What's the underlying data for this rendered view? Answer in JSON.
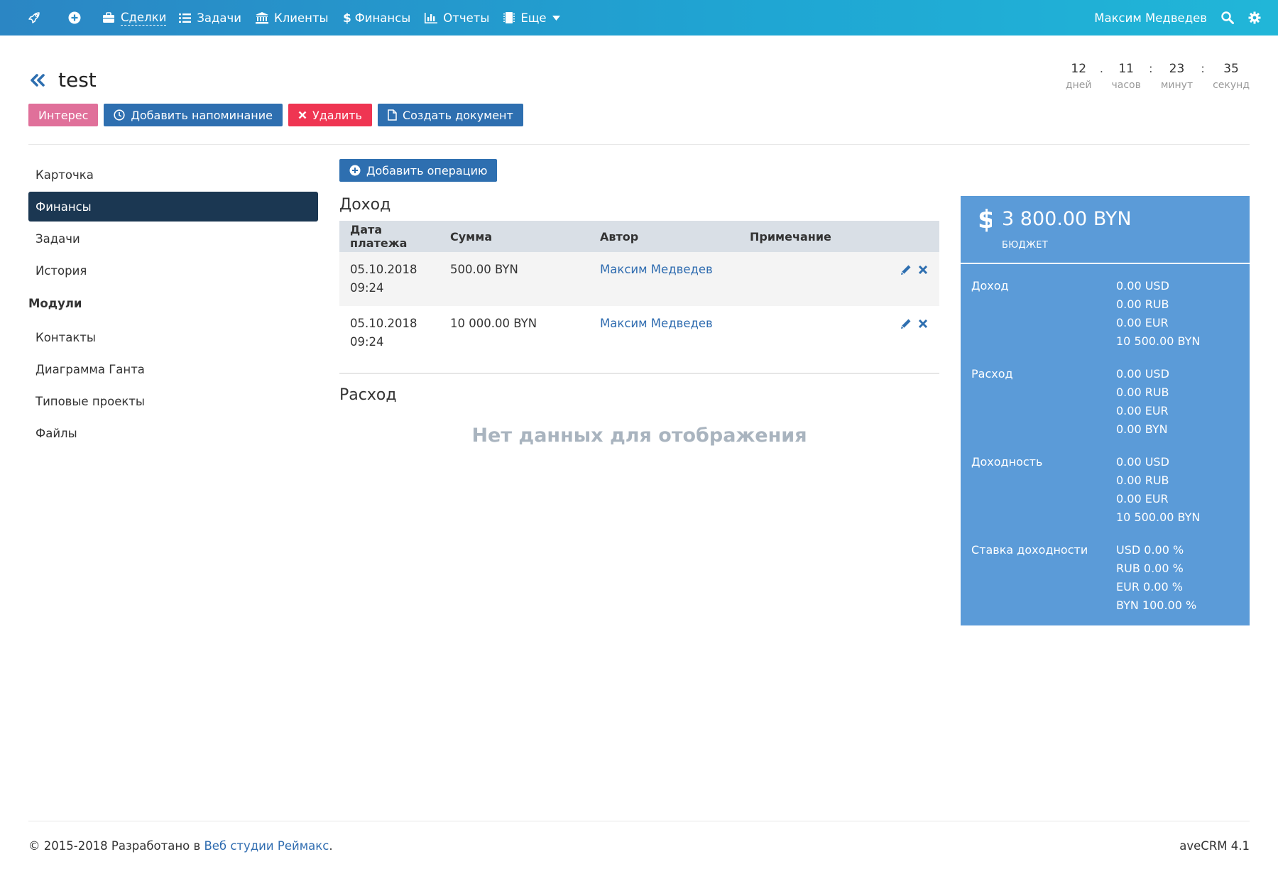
{
  "nav": {
    "items": [
      {
        "label": "Сделки",
        "icon": "briefcase-icon"
      },
      {
        "label": "Задачи",
        "icon": "list-icon"
      },
      {
        "label": "Клиенты",
        "icon": "bank-icon"
      },
      {
        "label": "Финансы",
        "icon": "dollar-icon"
      },
      {
        "label": "Отчеты",
        "icon": "bar-chart-icon"
      },
      {
        "label": "Еще",
        "icon": "chip-icon"
      }
    ],
    "user": "Максим Медведев"
  },
  "page": {
    "title": "test"
  },
  "timer": {
    "days": "12",
    "days_label": "дней",
    "hours": "11",
    "hours_label": "часов",
    "minutes": "23",
    "minutes_label": "минут",
    "seconds": "35",
    "seconds_label": "секунд",
    "sep1": ".",
    "sep2": ":",
    "sep3": ":"
  },
  "actions": {
    "status_label": "Интерес",
    "reminder_label": "Добавить напоминание",
    "delete_label": "Удалить",
    "create_doc_label": "Создать документ"
  },
  "sidebar": {
    "items": [
      "Карточка",
      "Финансы",
      "Задачи",
      "История"
    ],
    "modules_heading": "Модули",
    "modules": [
      "Контакты",
      "Диаграмма Ганта",
      "Типовые проекты",
      "Файлы"
    ]
  },
  "main": {
    "add_operation_label": "Добавить операцию",
    "income_title": "Доход",
    "columns": [
      "Дата платежа",
      "Сумма",
      "Автор",
      "Примечание"
    ],
    "income_rows": [
      {
        "date": "05.10.2018",
        "time": "09:24",
        "amount": "500.00 BYN",
        "author": "Максим Медведев",
        "note": ""
      },
      {
        "date": "05.10.2018",
        "time": "09:24",
        "amount": "10 000.00 BYN",
        "author": "Максим Медведев",
        "note": ""
      }
    ],
    "expense_title": "Расход",
    "no_data": "Нет данных для отображения"
  },
  "summary": {
    "budget_amount": "3 800.00 BYN",
    "budget_label": "Бюджет",
    "groups": [
      {
        "label": "Доход",
        "values": [
          "0.00 USD",
          "0.00 RUB",
          "0.00 EUR",
          "10 500.00 BYN"
        ]
      },
      {
        "label": "Расход",
        "values": [
          "0.00 USD",
          "0.00 RUB",
          "0.00 EUR",
          "0.00 BYN"
        ]
      },
      {
        "label": "Доходность",
        "values": [
          "0.00 USD",
          "0.00 RUB",
          "0.00 EUR",
          "10 500.00 BYN"
        ]
      },
      {
        "label": "Ставка доходности",
        "values": [
          "USD 0.00 %",
          "RUB 0.00 %",
          "EUR 0.00 %",
          "BYN 100.00 %"
        ]
      }
    ]
  },
  "footer": {
    "copyright": "© 2015-2018 Разработано в ",
    "studio_link": "Веб студии Реймакс",
    "period": ".",
    "version": "aveCRM 4.1"
  },
  "colors": {
    "nav_gradient_start": "#2b86c4",
    "nav_gradient_end": "#21b6d8",
    "primary": "#2e6fb0",
    "danger": "#ef3552",
    "status_pink": "#e0709a",
    "sidebar_active": "#1b3752",
    "summary_panel": "#5b9bd8",
    "amount_green": "#3aa046"
  }
}
